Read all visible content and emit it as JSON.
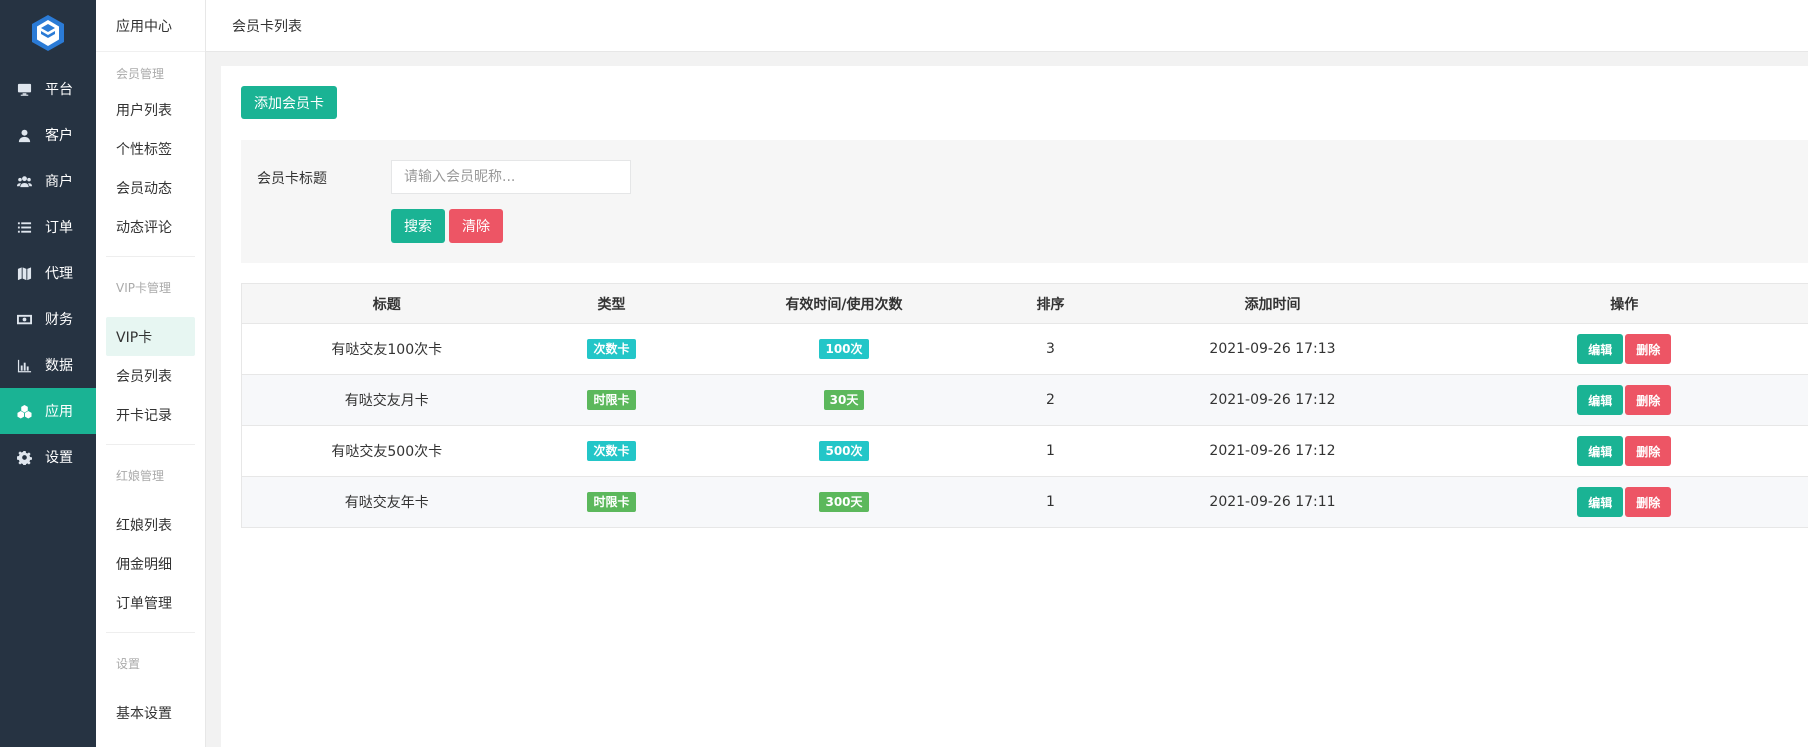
{
  "nav": {
    "items": [
      {
        "label": "平台",
        "icon": "monitor-icon"
      },
      {
        "label": "客户",
        "icon": "user-icon"
      },
      {
        "label": "商户",
        "icon": "users-icon"
      },
      {
        "label": "订单",
        "icon": "list-icon"
      },
      {
        "label": "代理",
        "icon": "map-icon"
      },
      {
        "label": "财务",
        "icon": "money-icon"
      },
      {
        "label": "数据",
        "icon": "bar-chart-icon"
      },
      {
        "label": "应用",
        "icon": "cubes-icon"
      },
      {
        "label": "设置",
        "icon": "gear-icon"
      }
    ],
    "active_index": 7
  },
  "subnav": {
    "head": "应用中心",
    "groups": [
      {
        "title": "会员管理",
        "items": [
          "用户列表",
          "个性标签",
          "会员动态",
          "动态评论"
        ]
      },
      {
        "title": "VIP卡管理",
        "items": [
          "VIP卡",
          "会员列表",
          "开卡记录"
        ]
      },
      {
        "title": "红娘管理",
        "items": [
          "红娘列表",
          "佣金明细",
          "订单管理"
        ]
      },
      {
        "title": "设置",
        "items": [
          "基本设置"
        ]
      }
    ],
    "active_item": "VIP卡"
  },
  "topbar": {
    "title": "会员卡列表"
  },
  "toolbar": {
    "add_label": "添加会员卡"
  },
  "search": {
    "label": "会员卡标题",
    "placeholder": "请输入会员昵称...",
    "search_label": "搜索",
    "clear_label": "清除"
  },
  "table": {
    "headers": [
      "标题",
      "类型",
      "有效时间/使用次数",
      "排序",
      "添加时间",
      "操作"
    ],
    "rows": [
      {
        "title": "有哒交友100次卡",
        "type": "次数卡",
        "type_color": "#23c6c8",
        "validity": "100次",
        "validity_color": "#23c6c8",
        "sort": "3",
        "time": "2021-09-26 17:13"
      },
      {
        "title": "有哒交友月卡",
        "type": "时限卡",
        "type_color": "#5cb85c",
        "validity": "30天",
        "validity_color": "#5cb85c",
        "sort": "2",
        "time": "2021-09-26 17:12"
      },
      {
        "title": "有哒交友500次卡",
        "type": "次数卡",
        "type_color": "#23c6c8",
        "validity": "500次",
        "validity_color": "#23c6c8",
        "sort": "1",
        "time": "2021-09-26 17:12"
      },
      {
        "title": "有哒交友年卡",
        "type": "时限卡",
        "type_color": "#5cb85c",
        "validity": "300天",
        "validity_color": "#5cb85c",
        "sort": "1",
        "time": "2021-09-26 17:11"
      }
    ],
    "edit_label": "编辑",
    "delete_label": "删除"
  },
  "colors": {
    "accent": "#1ab394",
    "danger": "#ed5565",
    "nav_bg": "#263342"
  }
}
